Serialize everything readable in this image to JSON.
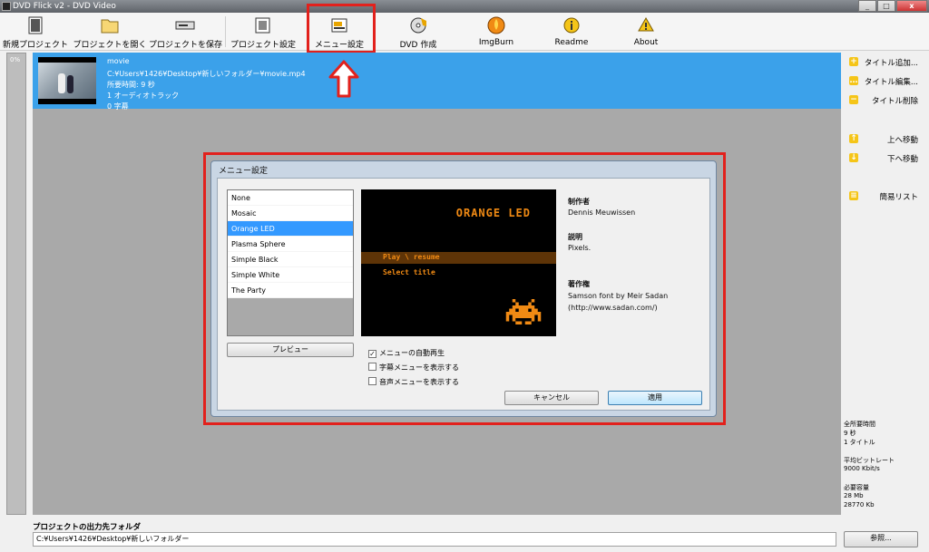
{
  "window": {
    "title": "DVD Flick v2 - DVD Video",
    "controls": [
      "_",
      "□",
      "x"
    ]
  },
  "toolbar": {
    "new_project": "新規プロジェクト",
    "open_project": "プロジェクトを開く",
    "save_project": "プロジェクトを保存",
    "project_settings": "プロジェクト設定",
    "menu_settings": "メニュー設定",
    "create_dvd": "DVD 作成",
    "imgburn": "ImgBurn",
    "readme": "Readme",
    "about": "About"
  },
  "progress": {
    "percent": "0%"
  },
  "title_list": [
    {
      "name": "movie",
      "path": "C:¥Users¥1426¥Desktop¥新しいフォルダー¥movie.mp4",
      "duration": "所要時間: 9 秒",
      "audio": "1 オーディオトラック",
      "subtitles": "0 字幕"
    }
  ],
  "dialog": {
    "title": "メニュー設定",
    "menu_options": [
      "None",
      "Mosaic",
      "Orange LED",
      "Plasma Sphere",
      "Simple Black",
      "Simple White",
      "The Party"
    ],
    "selected_index": 2,
    "preview_button": "プレビュー",
    "preview": {
      "heading": "ORANGE LED",
      "item1": "Play \\ resume",
      "item2": "Select title"
    },
    "info": {
      "author_label": "制作者",
      "author": "Dennis Meuwissen",
      "description_label": "説明",
      "description": "Pixels.",
      "copyright_label": "著作権",
      "copyright_line1": "Samson font by Meir Sadan",
      "copyright_line2": "(http://www.sadan.com/)"
    },
    "checkboxes": [
      {
        "label": "メニューの自動再生",
        "checked": true
      },
      {
        "label": "字幕メニューを表示する",
        "checked": false
      },
      {
        "label": "音声メニューを表示する",
        "checked": false
      }
    ],
    "cancel": "キャンセル",
    "apply": "適用"
  },
  "side_panel": {
    "add_title": "タイトル追加...",
    "edit_title": "タイトル編集...",
    "delete_title": "タイトル削除",
    "move_up": "上へ移動",
    "move_down": "下へ移動",
    "simple_list": "簡易リスト"
  },
  "stats": {
    "total_time_label": "全所要時間",
    "total_time": "9 秒",
    "titles": "1 タイトル",
    "avg_bitrate_label": "平均ビットレート",
    "avg_bitrate": "9000 Kbit/s",
    "required_size_label": "必要容量",
    "size_mb": "28 Mb",
    "size_kb": "28770 Kb"
  },
  "output": {
    "label": "プロジェクトの出力先フォルダ",
    "path": "C:¥Users¥1426¥Desktop¥新しいフォルダー",
    "browse": "参照..."
  },
  "colors": {
    "highlight_red": "#e2211c",
    "selection_blue": "#3ba1ea",
    "led_orange": "#f08a14"
  }
}
